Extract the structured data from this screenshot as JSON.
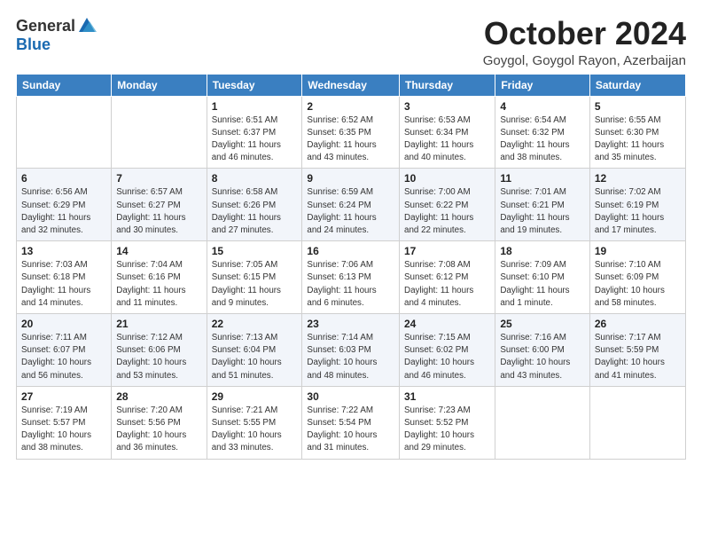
{
  "header": {
    "logo_general": "General",
    "logo_blue": "Blue",
    "month": "October 2024",
    "location": "Goygol, Goygol Rayon, Azerbaijan"
  },
  "weekdays": [
    "Sunday",
    "Monday",
    "Tuesday",
    "Wednesday",
    "Thursday",
    "Friday",
    "Saturday"
  ],
  "weeks": [
    [
      {
        "day": "",
        "detail": ""
      },
      {
        "day": "",
        "detail": ""
      },
      {
        "day": "1",
        "detail": "Sunrise: 6:51 AM\nSunset: 6:37 PM\nDaylight: 11 hours\nand 46 minutes."
      },
      {
        "day": "2",
        "detail": "Sunrise: 6:52 AM\nSunset: 6:35 PM\nDaylight: 11 hours\nand 43 minutes."
      },
      {
        "day": "3",
        "detail": "Sunrise: 6:53 AM\nSunset: 6:34 PM\nDaylight: 11 hours\nand 40 minutes."
      },
      {
        "day": "4",
        "detail": "Sunrise: 6:54 AM\nSunset: 6:32 PM\nDaylight: 11 hours\nand 38 minutes."
      },
      {
        "day": "5",
        "detail": "Sunrise: 6:55 AM\nSunset: 6:30 PM\nDaylight: 11 hours\nand 35 minutes."
      }
    ],
    [
      {
        "day": "6",
        "detail": "Sunrise: 6:56 AM\nSunset: 6:29 PM\nDaylight: 11 hours\nand 32 minutes."
      },
      {
        "day": "7",
        "detail": "Sunrise: 6:57 AM\nSunset: 6:27 PM\nDaylight: 11 hours\nand 30 minutes."
      },
      {
        "day": "8",
        "detail": "Sunrise: 6:58 AM\nSunset: 6:26 PM\nDaylight: 11 hours\nand 27 minutes."
      },
      {
        "day": "9",
        "detail": "Sunrise: 6:59 AM\nSunset: 6:24 PM\nDaylight: 11 hours\nand 24 minutes."
      },
      {
        "day": "10",
        "detail": "Sunrise: 7:00 AM\nSunset: 6:22 PM\nDaylight: 11 hours\nand 22 minutes."
      },
      {
        "day": "11",
        "detail": "Sunrise: 7:01 AM\nSunset: 6:21 PM\nDaylight: 11 hours\nand 19 minutes."
      },
      {
        "day": "12",
        "detail": "Sunrise: 7:02 AM\nSunset: 6:19 PM\nDaylight: 11 hours\nand 17 minutes."
      }
    ],
    [
      {
        "day": "13",
        "detail": "Sunrise: 7:03 AM\nSunset: 6:18 PM\nDaylight: 11 hours\nand 14 minutes."
      },
      {
        "day": "14",
        "detail": "Sunrise: 7:04 AM\nSunset: 6:16 PM\nDaylight: 11 hours\nand 11 minutes."
      },
      {
        "day": "15",
        "detail": "Sunrise: 7:05 AM\nSunset: 6:15 PM\nDaylight: 11 hours\nand 9 minutes."
      },
      {
        "day": "16",
        "detail": "Sunrise: 7:06 AM\nSunset: 6:13 PM\nDaylight: 11 hours\nand 6 minutes."
      },
      {
        "day": "17",
        "detail": "Sunrise: 7:08 AM\nSunset: 6:12 PM\nDaylight: 11 hours\nand 4 minutes."
      },
      {
        "day": "18",
        "detail": "Sunrise: 7:09 AM\nSunset: 6:10 PM\nDaylight: 11 hours\nand 1 minute."
      },
      {
        "day": "19",
        "detail": "Sunrise: 7:10 AM\nSunset: 6:09 PM\nDaylight: 10 hours\nand 58 minutes."
      }
    ],
    [
      {
        "day": "20",
        "detail": "Sunrise: 7:11 AM\nSunset: 6:07 PM\nDaylight: 10 hours\nand 56 minutes."
      },
      {
        "day": "21",
        "detail": "Sunrise: 7:12 AM\nSunset: 6:06 PM\nDaylight: 10 hours\nand 53 minutes."
      },
      {
        "day": "22",
        "detail": "Sunrise: 7:13 AM\nSunset: 6:04 PM\nDaylight: 10 hours\nand 51 minutes."
      },
      {
        "day": "23",
        "detail": "Sunrise: 7:14 AM\nSunset: 6:03 PM\nDaylight: 10 hours\nand 48 minutes."
      },
      {
        "day": "24",
        "detail": "Sunrise: 7:15 AM\nSunset: 6:02 PM\nDaylight: 10 hours\nand 46 minutes."
      },
      {
        "day": "25",
        "detail": "Sunrise: 7:16 AM\nSunset: 6:00 PM\nDaylight: 10 hours\nand 43 minutes."
      },
      {
        "day": "26",
        "detail": "Sunrise: 7:17 AM\nSunset: 5:59 PM\nDaylight: 10 hours\nand 41 minutes."
      }
    ],
    [
      {
        "day": "27",
        "detail": "Sunrise: 7:19 AM\nSunset: 5:57 PM\nDaylight: 10 hours\nand 38 minutes."
      },
      {
        "day": "28",
        "detail": "Sunrise: 7:20 AM\nSunset: 5:56 PM\nDaylight: 10 hours\nand 36 minutes."
      },
      {
        "day": "29",
        "detail": "Sunrise: 7:21 AM\nSunset: 5:55 PM\nDaylight: 10 hours\nand 33 minutes."
      },
      {
        "day": "30",
        "detail": "Sunrise: 7:22 AM\nSunset: 5:54 PM\nDaylight: 10 hours\nand 31 minutes."
      },
      {
        "day": "31",
        "detail": "Sunrise: 7:23 AM\nSunset: 5:52 PM\nDaylight: 10 hours\nand 29 minutes."
      },
      {
        "day": "",
        "detail": ""
      },
      {
        "day": "",
        "detail": ""
      }
    ]
  ]
}
